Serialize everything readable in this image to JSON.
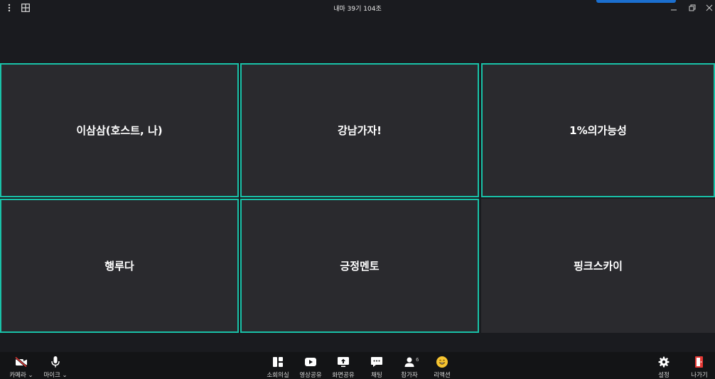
{
  "window": {
    "title": "내마 39기 104조"
  },
  "participants": [
    {
      "name": "이삼삼(호스트, 나)",
      "speaking": true
    },
    {
      "name": "강남가자!",
      "speaking": true
    },
    {
      "name": "1%의가능성",
      "speaking": true
    },
    {
      "name": "행루다",
      "speaking": true
    },
    {
      "name": "긍정멘토",
      "speaking": true
    },
    {
      "name": "핑크스카이",
      "speaking": false
    }
  ],
  "toolbar": {
    "camera_label": "카메라",
    "mic_label": "마이크",
    "breakout_label": "소회의실",
    "video_share_label": "영상공유",
    "screen_share_label": "화면공유",
    "chat_label": "채팅",
    "participants_label": "참가자",
    "participants_count": "6",
    "reaction_label": "리액션",
    "settings_label": "설정",
    "leave_label": "나가기"
  },
  "colors": {
    "active_border": "#19c2a8",
    "leave_red": "#e53935",
    "accent_blue": "#1b6fcf"
  }
}
